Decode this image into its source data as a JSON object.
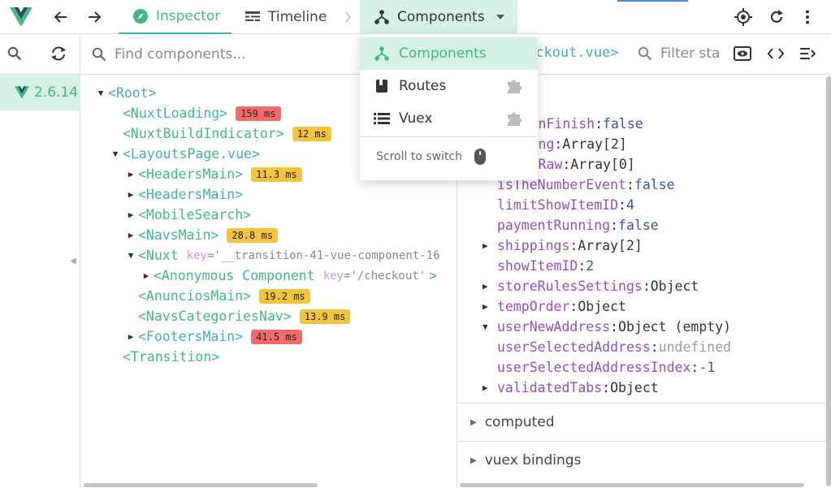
{
  "topbar": {
    "tabs": [
      {
        "label": "Inspector"
      },
      {
        "label": "Timeline"
      },
      {
        "label": "Components"
      }
    ]
  },
  "rail": {
    "version": "2.6.14"
  },
  "tree": {
    "search_placeholder": "Find components...",
    "nodes": [
      {
        "tag": "<Root>"
      },
      {
        "tag": "<NuxtLoading>",
        "time": "159 ms"
      },
      {
        "tag": "<NuxtBuildIndicator>",
        "time": "12 ms"
      },
      {
        "tag": "<LayoutsPage.vue>"
      },
      {
        "tag": "<HeadersMain>",
        "time": "11.3 ms"
      },
      {
        "tag": "<HeadersMain>"
      },
      {
        "tag": "<MobileSearch>"
      },
      {
        "tag": "<NavsMain>",
        "time": "28.8 ms"
      },
      {
        "tag": "<Nuxt",
        "attr": "key",
        "attr_value": "='__transition-41-vue-component-16"
      },
      {
        "tag": "<Anonymous Component",
        "attr": "key",
        "attr_value": "='/checkout'",
        "close": ">"
      },
      {
        "tag": "<AnunciosMain>",
        "time": "19.2 ms"
      },
      {
        "tag": "<NavsCategoriesNav>",
        "time": "13.9 ms"
      },
      {
        "tag": "<FootersMain>",
        "time": "41.5 ms"
      },
      {
        "tag": "<Transition>"
      }
    ]
  },
  "inspector": {
    "component_name": "eckout.vue>",
    "filter_placeholder": "Filter sta",
    "props": [
      {
        "key": "veButtonFinish",
        "value": "false"
      },
      {
        "key": "yShipping",
        "value": "Array[2]"
      },
      {
        "key": "allmentRaw",
        "value": "Array[0]"
      },
      {
        "key": "isTheNumberEvent",
        "value": "false"
      },
      {
        "key": "limitShowItemID",
        "value": "4"
      },
      {
        "key": "paymentRunning",
        "value": "false"
      },
      {
        "key": "shippings",
        "value": "Array[2]"
      },
      {
        "key": "showItemID",
        "value": "2"
      },
      {
        "key": "storeRulesSettings",
        "value": "Object"
      },
      {
        "key": "tempOrder",
        "value": "Object"
      },
      {
        "key": "userNewAddress",
        "value": "Object (empty)"
      },
      {
        "key": "userSelectedAddress",
        "value": "undefined"
      },
      {
        "key": "userSelectedAddressIndex",
        "value": "-1"
      },
      {
        "key": "validatedTabs",
        "value": "Object"
      }
    ],
    "sections": [
      {
        "label": "computed"
      },
      {
        "label": "vuex bindings"
      }
    ]
  },
  "dropdown": {
    "items": [
      {
        "label": "Components"
      },
      {
        "label": "Routes"
      },
      {
        "label": "Vuex"
      }
    ],
    "hint": "Scroll to switch"
  },
  "colors": {
    "vue_green": "#42b883",
    "active_bg": "#d6f1e6",
    "prop_key": "#8f4fc7",
    "prop_literal": "#3d4fb8",
    "badge_red": "#f26a6a",
    "badge_yellow": "#f4c43c"
  }
}
